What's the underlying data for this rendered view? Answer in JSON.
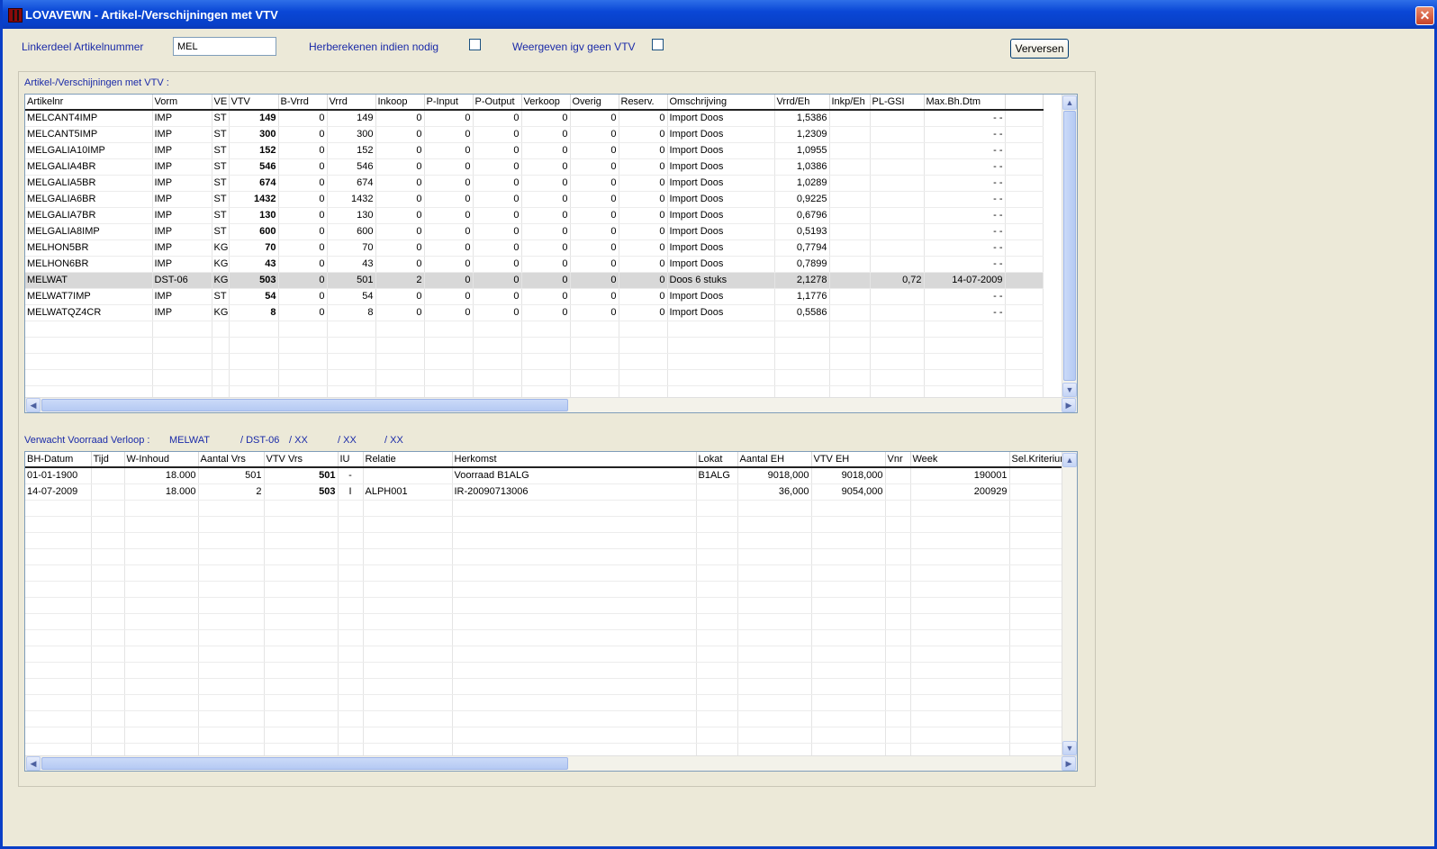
{
  "window": {
    "title": "LOVAVEWN - Artikel-/Verschijningen met VTV",
    "close_glyph": "✕"
  },
  "filter": {
    "article_label": "Linkerdeel Artikelnummer",
    "article_value": "MEL",
    "recalc_label": "Herberekenen indien nodig",
    "recalc_checked": false,
    "show_no_vtv_label": "Weergeven igv geen VTV",
    "show_no_vtv_checked": false,
    "refresh_label": "Verversen"
  },
  "top_grid": {
    "caption": "Artikel-/Verschijningen met VTV :",
    "columns": [
      "Artikelnr",
      "Vorm",
      "VE",
      "VTV",
      "B-Vrrd",
      "Vrrd",
      "Inkoop",
      "P-Input",
      "P-Output",
      "Verkoop",
      "Overig",
      "Reserv.",
      "Omschrijving",
      "Vrrd/Eh",
      "Inkp/Eh",
      "PL-GSI",
      "Max.Bh.Dtm",
      ""
    ],
    "rows": [
      [
        "MELCANT4IMP",
        "IMP",
        "ST",
        "149",
        "0",
        "149",
        "0",
        "0",
        "0",
        "0",
        "0",
        "0",
        "Import Doos",
        "1,5386",
        "",
        "",
        "- -",
        ""
      ],
      [
        "MELCANT5IMP",
        "IMP",
        "ST",
        "300",
        "0",
        "300",
        "0",
        "0",
        "0",
        "0",
        "0",
        "0",
        "Import Doos",
        "1,2309",
        "",
        "",
        "- -",
        ""
      ],
      [
        "MELGALIA10IMP",
        "IMP",
        "ST",
        "152",
        "0",
        "152",
        "0",
        "0",
        "0",
        "0",
        "0",
        "0",
        "Import Doos",
        "1,0955",
        "",
        "",
        "- -",
        ""
      ],
      [
        "MELGALIA4BR",
        "IMP",
        "ST",
        "546",
        "0",
        "546",
        "0",
        "0",
        "0",
        "0",
        "0",
        "0",
        "Import Doos",
        "1,0386",
        "",
        "",
        "- -",
        ""
      ],
      [
        "MELGALIA5BR",
        "IMP",
        "ST",
        "674",
        "0",
        "674",
        "0",
        "0",
        "0",
        "0",
        "0",
        "0",
        "Import Doos",
        "1,0289",
        "",
        "",
        "- -",
        ""
      ],
      [
        "MELGALIA6BR",
        "IMP",
        "ST",
        "1432",
        "0",
        "1432",
        "0",
        "0",
        "0",
        "0",
        "0",
        "0",
        "Import Doos",
        "0,9225",
        "",
        "",
        "- -",
        ""
      ],
      [
        "MELGALIA7BR",
        "IMP",
        "ST",
        "130",
        "0",
        "130",
        "0",
        "0",
        "0",
        "0",
        "0",
        "0",
        "Import Doos",
        "0,6796",
        "",
        "",
        "- -",
        ""
      ],
      [
        "MELGALIA8IMP",
        "IMP",
        "ST",
        "600",
        "0",
        "600",
        "0",
        "0",
        "0",
        "0",
        "0",
        "0",
        "Import Doos",
        "0,5193",
        "",
        "",
        "- -",
        ""
      ],
      [
        "MELHON5BR",
        "IMP",
        "KG",
        "70",
        "0",
        "70",
        "0",
        "0",
        "0",
        "0",
        "0",
        "0",
        "Import Doos",
        "0,7794",
        "",
        "",
        "- -",
        ""
      ],
      [
        "MELHON6BR",
        "IMP",
        "KG",
        "43",
        "0",
        "43",
        "0",
        "0",
        "0",
        "0",
        "0",
        "0",
        "Import Doos",
        "0,7899",
        "",
        "",
        "- -",
        ""
      ],
      [
        "MELWAT",
        "DST-06",
        "KG",
        "503",
        "0",
        "501",
        "2",
        "0",
        "0",
        "0",
        "0",
        "0",
        "Doos 6 stuks",
        "2,1278",
        "",
        "0,72",
        "14-07-2009",
        ""
      ],
      [
        "MELWAT7IMP",
        "IMP",
        "ST",
        "54",
        "0",
        "54",
        "0",
        "0",
        "0",
        "0",
        "0",
        "0",
        "Import Doos",
        "1,1776",
        "",
        "",
        "- -",
        ""
      ],
      [
        "MELWATQZ4CR",
        "IMP",
        "KG",
        "8",
        "0",
        "8",
        "0",
        "0",
        "0",
        "0",
        "0",
        "0",
        "Import Doos",
        "0,5586",
        "",
        "",
        "- -",
        ""
      ]
    ],
    "empty_rows": 5,
    "selected_row": 10
  },
  "sub_header": {
    "label": "Verwacht Voorraad Verloop :",
    "article": "MELWAT",
    "vorm": "/ DST-06",
    "x1": "/ XX",
    "x2": "/ XX",
    "x3": "/ XX"
  },
  "bottom_grid": {
    "columns": [
      "BH-Datum",
      "Tijd",
      "W-Inhoud",
      "Aantal Vrs",
      "VTV Vrs",
      "IU",
      "Relatie",
      "Herkomst",
      "Lokat",
      "Aantal EH",
      "VTV EH",
      "Vnr",
      "Week",
      "Sel.Kriterium"
    ],
    "rows": [
      [
        "01-01-1900",
        "",
        "18.000",
        "501",
        "501",
        "-",
        "",
        "Voorraad B1ALG",
        "B1ALG",
        "9018,000",
        "9018,000",
        "",
        "190001",
        ""
      ],
      [
        "14-07-2009",
        "",
        "18.000",
        "2",
        "503",
        "I",
        "ALPH001",
        "IR-20090713006",
        "",
        "36,000",
        "9054,000",
        "",
        "200929",
        ""
      ]
    ],
    "empty_rows": 16
  },
  "icons": {
    "up": "▲",
    "down": "▼",
    "left": "◀",
    "right": "▶",
    "grip": "≡"
  }
}
